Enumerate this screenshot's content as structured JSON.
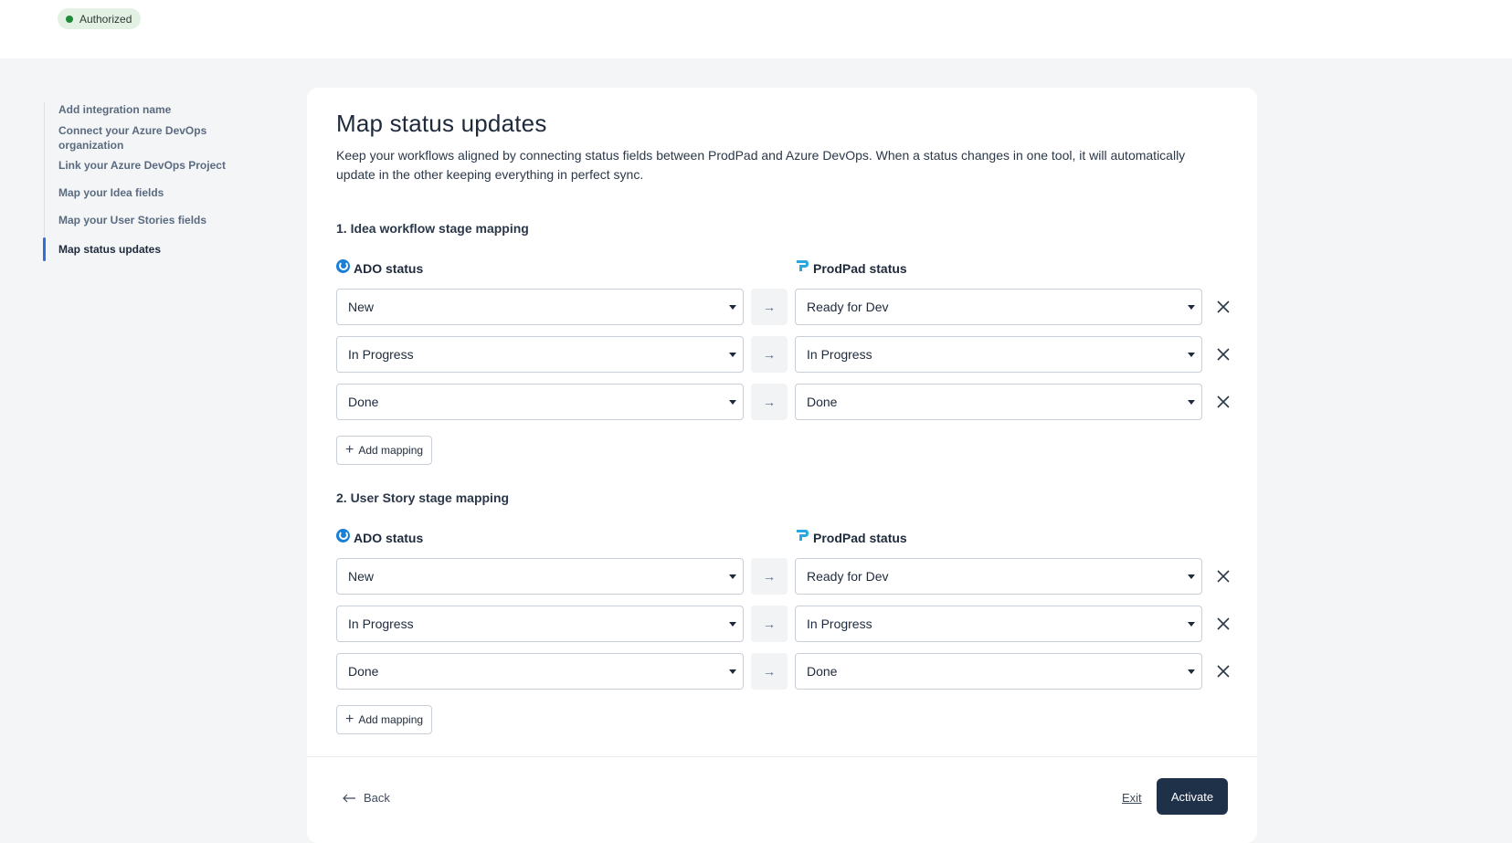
{
  "header": {
    "status_badge": "Authorized",
    "status_color": "#1f8a3a"
  },
  "sidebar": {
    "steps": [
      {
        "label": "Add integration name",
        "active": false
      },
      {
        "label": "Connect your Azure DevOps organization",
        "active": false
      },
      {
        "label": "Link your Azure DevOps Project",
        "active": false
      },
      {
        "label": "Map your Idea fields",
        "active": false
      },
      {
        "label": "Map your User Stories fields",
        "active": false
      },
      {
        "label": "Map status updates",
        "active": true
      }
    ]
  },
  "main": {
    "title": "Map status updates",
    "description": "Keep your workflows aligned by connecting status fields between ProdPad and Azure DevOps. When a status changes in one tool, it will automatically update in the other keeping everything in perfect sync.",
    "sections": [
      {
        "title": "1. Idea workflow stage mapping",
        "ado_header": "ADO status",
        "prodpad_header": "ProdPad status",
        "rows": [
          {
            "ado": "New",
            "prodpad": "Ready for Dev"
          },
          {
            "ado": "In Progress",
            "prodpad": "In Progress"
          },
          {
            "ado": "Done",
            "prodpad": "Done"
          }
        ],
        "add_label": "Add mapping"
      },
      {
        "title": "2. User Story stage mapping",
        "ado_header": "ADO status",
        "prodpad_header": "ProdPad status",
        "rows": [
          {
            "ado": "New",
            "prodpad": "Ready for Dev"
          },
          {
            "ado": "In Progress",
            "prodpad": "In Progress"
          },
          {
            "ado": "Done",
            "prodpad": "Done"
          }
        ],
        "add_label": "Add mapping"
      }
    ]
  },
  "footer": {
    "back_label": "Back",
    "exit_label": "Exit",
    "activate_label": "Activate"
  },
  "colors": {
    "accent": "#2f6fd6",
    "primary_button": "#1f3149",
    "ado_icon": "#1b7fd6",
    "prodpad_icon": "#2aa7e0"
  },
  "icons": {
    "arrow": "arrow-right-icon",
    "remove": "close-icon",
    "add": "plus-icon",
    "back": "arrow-left-icon"
  }
}
